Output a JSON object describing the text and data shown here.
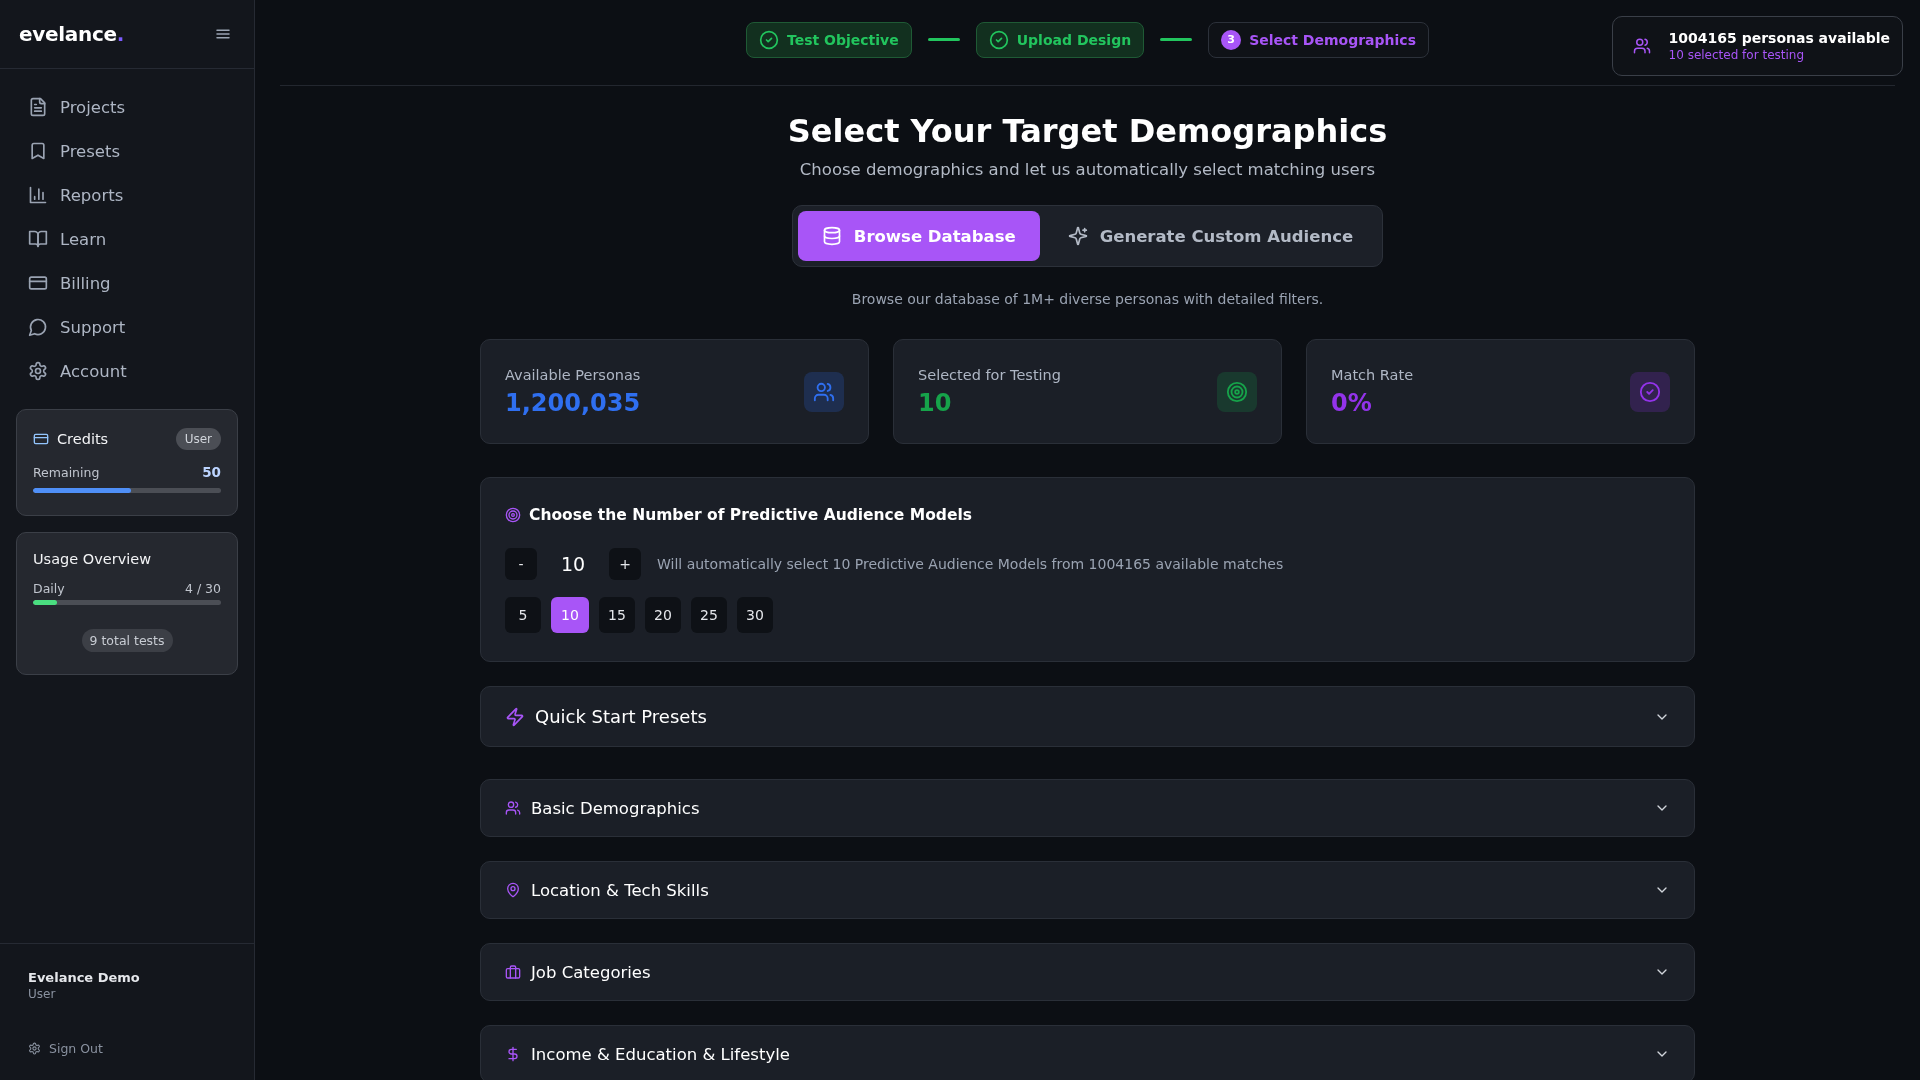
{
  "sidebar": {
    "logo": {
      "text": "evelance",
      "mark": "."
    },
    "nav": [
      {
        "label": "Projects",
        "kind": "projects"
      },
      {
        "label": "Presets",
        "kind": "presets"
      },
      {
        "label": "Reports",
        "kind": "reports"
      },
      {
        "label": "Learn",
        "kind": "learn"
      },
      {
        "label": "Billing",
        "kind": "billing"
      },
      {
        "label": "Support",
        "kind": "support"
      },
      {
        "label": "Account",
        "kind": "account"
      }
    ],
    "credits": {
      "title": "Credits",
      "badge": "User",
      "label": "Remaining",
      "value": "50",
      "level": 0.52
    },
    "usage": {
      "title": "Usage Overview",
      "label": "Daily",
      "value": "4 / 30",
      "level": 0.13,
      "footer": "9 total tests"
    },
    "user": {
      "name": "Evelance Demo",
      "role": "User"
    },
    "sign_out": "Sign Out"
  },
  "steps": [
    {
      "label": "Test Objective",
      "completed": true
    },
    {
      "label": "Upload Design",
      "completed": true
    },
    {
      "label": "Select Demographics",
      "completed": false,
      "number": "3"
    }
  ],
  "personas_badge": {
    "title": "1004165 personas available",
    "subtitle": "10 selected for testing"
  },
  "heading": "Select Your Target Demographics",
  "subheading": "Choose demographics and let us automatically select matching users",
  "modes": [
    {
      "label": "Browse Database",
      "kind": "database",
      "selected": true
    },
    {
      "label": "Generate Custom Audience",
      "kind": "generate",
      "selected": false
    }
  ],
  "mode_description": "Browse our database of 1M+ diverse personas with detailed filters.",
  "stats": [
    {
      "label": "Available Personas",
      "value": "1,200,035",
      "color": "#2f6ff0",
      "kind": "personas"
    },
    {
      "label": "Selected for Testing",
      "value": "10",
      "color": "#16a34a",
      "kind": "selected"
    },
    {
      "label": "Match Rate",
      "value": "0%",
      "color": "#9333ea",
      "kind": "match"
    }
  ],
  "models": {
    "title": "Choose the Number of Predictive Audience Models",
    "decrement": "-",
    "value": "10",
    "increment": "+",
    "note": "Will automatically select 10 Predictive Audience Models from 1004165 available matches",
    "presets": [
      {
        "label": "5",
        "selected": false
      },
      {
        "label": "10",
        "selected": true
      },
      {
        "label": "15",
        "selected": false
      },
      {
        "label": "20",
        "selected": false
      },
      {
        "label": "25",
        "selected": false
      },
      {
        "label": "30",
        "selected": false
      }
    ]
  },
  "sections": [
    {
      "title": "Quick Start Presets",
      "kind": "presets",
      "expanded": false
    },
    {
      "title": "Basic Demographics",
      "kind": "demographics",
      "expanded": false
    },
    {
      "title": "Location & Tech Skills",
      "kind": "location",
      "expanded": false
    },
    {
      "title": "Job Categories",
      "kind": "jobs",
      "expanded": false
    },
    {
      "title": "Income & Education & Lifestyle",
      "kind": "income",
      "expanded": false
    }
  ]
}
